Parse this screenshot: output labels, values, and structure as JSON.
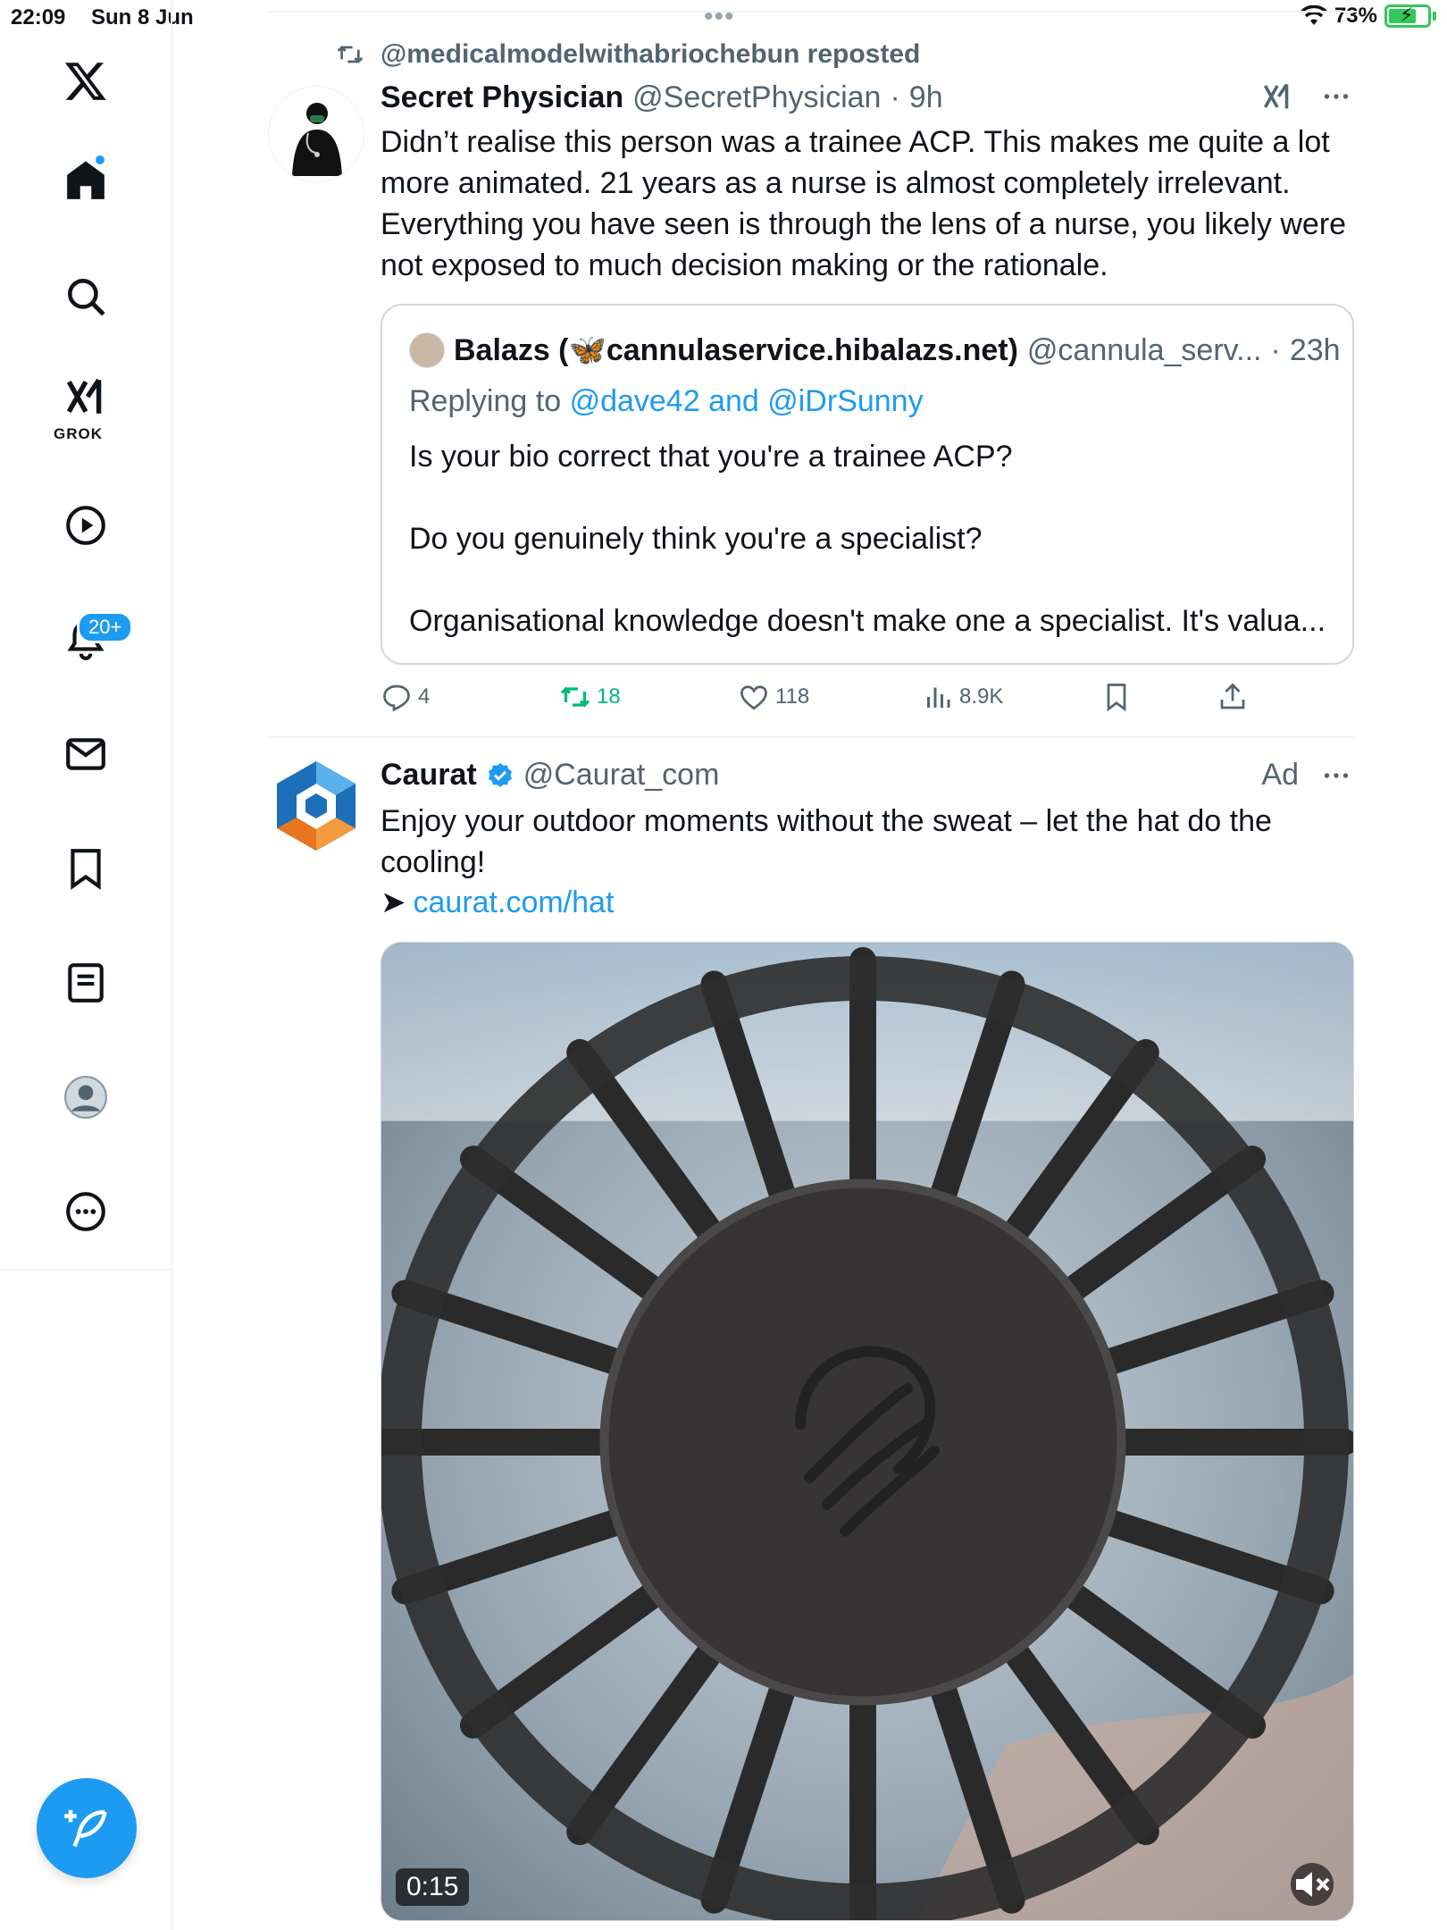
{
  "status_bar": {
    "time": "22:09",
    "date": "Sun 8 Jun",
    "battery": "73%"
  },
  "sidebar": {
    "items": [
      {
        "name": "x-logo",
        "icon": "x-logo"
      },
      {
        "name": "home",
        "icon": "home-icon"
      },
      {
        "name": "search",
        "icon": "search-icon"
      },
      {
        "name": "grok",
        "icon": "grok-icon",
        "label": "GROK"
      },
      {
        "name": "video",
        "icon": "play-icon"
      },
      {
        "name": "notifications",
        "icon": "bell-icon",
        "badge": "20+"
      },
      {
        "name": "messages",
        "icon": "mail-icon"
      },
      {
        "name": "bookmarks",
        "icon": "bookmark-icon"
      },
      {
        "name": "lists",
        "icon": "list-icon"
      },
      {
        "name": "profile",
        "icon": "avatar-icon"
      },
      {
        "name": "more",
        "icon": "more-icon"
      }
    ],
    "grok_label": "GROK",
    "notif_badge": "20+"
  },
  "colors": {
    "accent": "#1d9bf0",
    "retweet": "#00ba7c",
    "muted": "#536471",
    "border": "#cfd9de"
  },
  "tweet": {
    "repost_text": "@medicalmodelwithabriochebun reposted",
    "author_name": "Secret Physician",
    "author_handle": "@SecretPhysician",
    "time": "9h",
    "body": "Didn’t realise this person was a trainee ACP. This makes me quite a lot more animated. 21 years as a nurse is almost completely irrelevant. Everything you have seen is through the lens of a nurse, you likely were not exposed to much decision making or the rationale.",
    "quote": {
      "name": "Balazs (🦋cannulaservice.hibalazs.net)",
      "handle": "@cannula_serv...",
      "time": "23h",
      "replying_prefix": "Replying to",
      "replying_to": "@dave42 and @iDrSunny",
      "lines": [
        "Is your bio correct that you're a trainee ACP?",
        "Do you genuinely think you're a specialist?",
        "Organisational knowledge doesn't make one a specialist. It's valua..."
      ]
    },
    "stats": {
      "replies": "4",
      "reposts": "18",
      "likes": "118",
      "views": "8.9K"
    }
  },
  "ad": {
    "name": "Caurat",
    "handle": "@Caurat_com",
    "label": "Ad",
    "body": "Enjoy your outdoor moments without the sweat – let the hat do the cooling!",
    "arrow": "➤",
    "link": "caurat.com/hat",
    "video_duration": "0:15"
  }
}
